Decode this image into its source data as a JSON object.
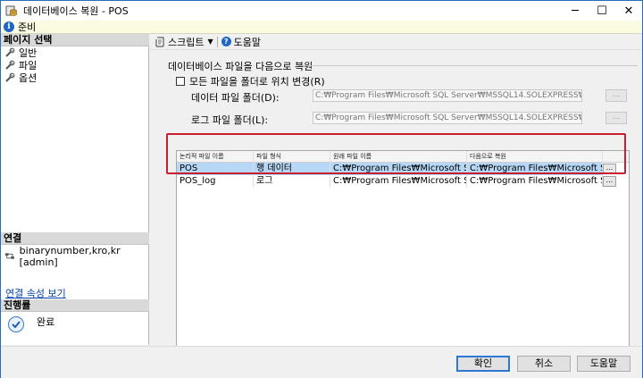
{
  "window": {
    "title": "데이터베이스 복원 - POS",
    "minimize_glyph": "─",
    "maximize_glyph": "☐",
    "close_glyph": "✕"
  },
  "status": {
    "text": "준비",
    "icon": "info-icon"
  },
  "left_panel": {
    "page_select_header": "페이지 선택",
    "pages": [
      {
        "label": "일반",
        "icon": "wrench-icon"
      },
      {
        "label": "파일",
        "icon": "wrench-icon"
      },
      {
        "label": "옵션",
        "icon": "wrench-icon"
      }
    ],
    "connection_header": "연결",
    "connection": {
      "label": "binarynumber,kro,kr [admin]",
      "icon": "connection-icon"
    },
    "connection_link": "연결 속성 보기",
    "progress_header": "진행률",
    "progress_status": "완료"
  },
  "toolbar": {
    "script_label": "스크립트",
    "help_label": "도움말"
  },
  "files": {
    "group_title": "데이터베이스 파일을 다음으로 복원",
    "relocate_checkbox_label": "모든 파일을 폴더로 위치 변경(R)",
    "relocate_checked": false,
    "data_folder_label": "데이터 파일 폴더(D):",
    "data_folder_value": "C:₩Program Files₩Microsoft SQL Server₩MSSQL14.SOLEXPRESS₩MSSC",
    "log_folder_label": "로그 파일 폴더(L):",
    "log_folder_value": "C:₩Program Files₩Microsoft SQL Server₩MSSQL14.SOLEXPRESS₩MSSC",
    "browse_label": "..."
  },
  "grid": {
    "columns": [
      "논리적 파일 이름",
      "파일 형식",
      "원래 파일 이름",
      "다음으로 복원"
    ],
    "rows": [
      {
        "logical": "POS",
        "type": "행 데이터",
        "original": "C:₩Program Files₩Microsoft S...",
        "restore_as": "C:₩Program Files₩Microsoft S...",
        "button": "..."
      },
      {
        "logical": "POS_log",
        "type": "로그",
        "original": "C:₩Program Files₩Microsoft S...",
        "restore_as": "C:₩Program Files₩Microsoft S...",
        "button": "..."
      }
    ]
  },
  "buttons": {
    "ok": "확인",
    "cancel": "취소",
    "help": "도움말"
  },
  "colors": {
    "highlight_border": "#c81f2e",
    "selection": "#b6d7f5",
    "accent": "#1f66c4"
  }
}
